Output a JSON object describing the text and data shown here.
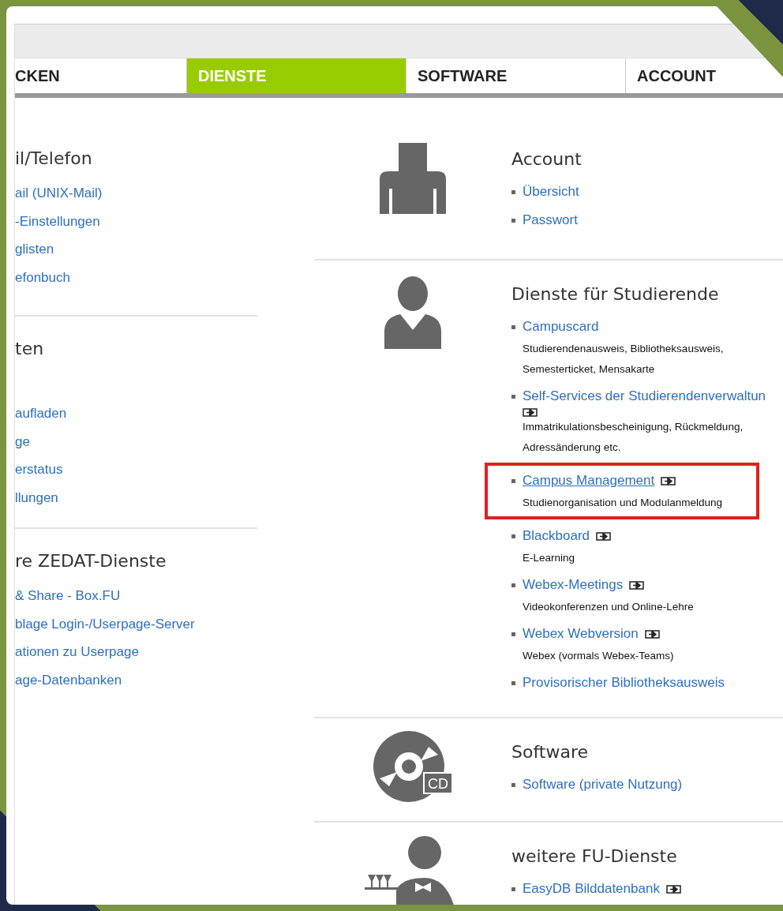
{
  "tabs": [
    {
      "label": "CKEN",
      "selected": false
    },
    {
      "label": "DIENSTE",
      "selected": true
    },
    {
      "label": "SOFTWARE",
      "selected": false
    },
    {
      "label": "ACCOUNT",
      "selected": false
    }
  ],
  "left_sections": [
    {
      "title": "il/Telefon",
      "links": [
        "ail (UNIX-Mail)",
        "-Einstellungen",
        "glisten",
        "efonbuch"
      ]
    },
    {
      "title": "ten",
      "links": [
        "aufladen",
        "ge",
        "erstatus",
        "llungen"
      ]
    },
    {
      "title": "re ZEDAT-Dienste",
      "links": [
        "& Share - Box.FU",
        "blage Login-/Userpage-Server",
        "ationen zu Userpage",
        "age-Datenbanken"
      ]
    }
  ],
  "sections": [
    {
      "kind": "account",
      "title": "Account",
      "items": [
        {
          "label": "Übersicht",
          "external": false,
          "highlighted": false
        },
        {
          "label": "Passwort",
          "external": false,
          "highlighted": false
        }
      ]
    },
    {
      "kind": "students",
      "title": "Dienste für Studierende",
      "items": [
        {
          "label": "Campuscard",
          "external": false,
          "highlighted": false,
          "description": "Studierendenausweis, Bibliotheksausweis, Semesterticket, Mensakarte"
        },
        {
          "label": "Self-Services der Studierendenverwaltun",
          "external": true,
          "highlighted": false,
          "description": "Immatrikulationsbescheinigung, Rückmeldung, Adressänderung etc."
        },
        {
          "label": "Campus Management",
          "external": true,
          "highlighted": true,
          "description": "Studienorganisation und Modulanmeldung"
        },
        {
          "label": "Blackboard",
          "external": true,
          "highlighted": false,
          "description": "E-Learning"
        },
        {
          "label": "Webex-Meetings",
          "external": true,
          "highlighted": false,
          "description": "Videokonferenzen und Online-Lehre"
        },
        {
          "label": "Webex Webversion",
          "external": true,
          "highlighted": false,
          "description": "Webex (vormals Webex-Teams)"
        },
        {
          "label": "Provisorischer Bibliotheksausweis",
          "external": false,
          "highlighted": false
        }
      ]
    },
    {
      "kind": "software",
      "icon_text": "CD",
      "title": "Software",
      "items": [
        {
          "label": "Software (private Nutzung)",
          "external": false,
          "highlighted": false
        }
      ]
    },
    {
      "kind": "services",
      "title": "weitere FU-Dienste",
      "items": [
        {
          "label": "EasyDB Bilddatenbank",
          "external": true,
          "highlighted": false
        }
      ]
    }
  ]
}
